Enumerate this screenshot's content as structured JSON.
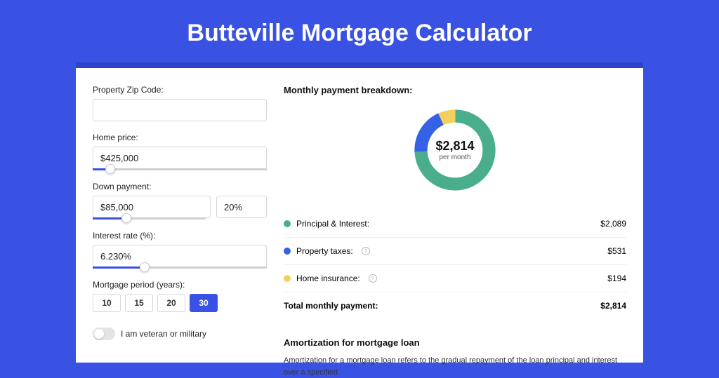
{
  "title": "Butteville Mortgage Calculator",
  "left": {
    "zip_label": "Property Zip Code:",
    "zip_value": "",
    "home_price_label": "Home price:",
    "home_price_value": "$425,000",
    "down_payment_label": "Down payment:",
    "down_payment_value": "$85,000",
    "down_payment_pct": "20%",
    "interest_label": "Interest rate (%):",
    "interest_value": "6.230%",
    "period_label": "Mortgage period (years):",
    "period_options": [
      "10",
      "15",
      "20",
      "30"
    ],
    "period_selected": "30",
    "veteran_label": "I am veteran or military"
  },
  "right": {
    "heading": "Monthly payment breakdown:",
    "total_amount": "$2,814",
    "total_sub": "per month",
    "rows": [
      {
        "label": "Principal & Interest:",
        "value": "$2,089",
        "color": "#4aae8c",
        "info": false
      },
      {
        "label": "Property taxes:",
        "value": "$531",
        "color": "#3561e6",
        "info": true
      },
      {
        "label": "Home insurance:",
        "value": "$194",
        "color": "#f3cf5b",
        "info": true
      }
    ],
    "total_row": {
      "label": "Total monthly payment:",
      "value": "$2,814"
    },
    "amort_heading": "Amortization for mortgage loan",
    "amort_text": "Amortization for a mortgage loan refers to the gradual repayment of the loan principal and interest over a specified"
  },
  "chart_data": {
    "type": "pie",
    "title": "Monthly payment breakdown",
    "center_label": "$2,814 per month",
    "series": [
      {
        "name": "Principal & Interest",
        "value": 2089,
        "color": "#4aae8c"
      },
      {
        "name": "Property taxes",
        "value": 531,
        "color": "#3561e6"
      },
      {
        "name": "Home insurance",
        "value": 194,
        "color": "#f3cf5b"
      }
    ],
    "total": 2814
  }
}
